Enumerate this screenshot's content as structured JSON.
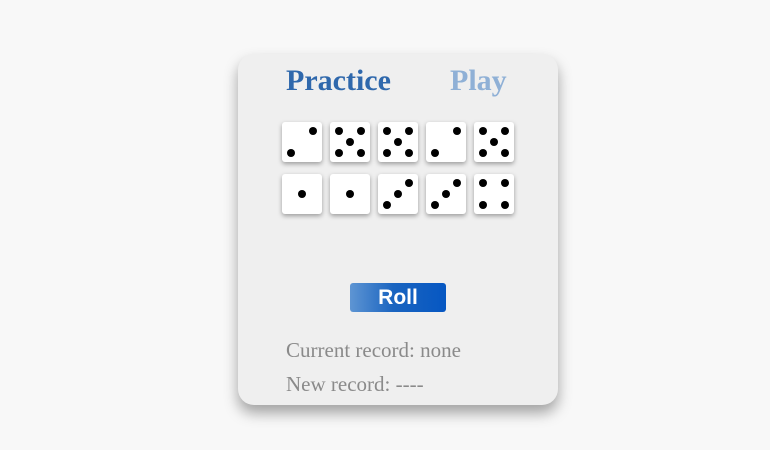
{
  "tabs": {
    "practice": "Practice",
    "play": "Play",
    "active": "practice"
  },
  "dice": [
    {
      "value": 2
    },
    {
      "value": 5
    },
    {
      "value": 5
    },
    {
      "value": 2
    },
    {
      "value": 5
    },
    {
      "value": 1
    },
    {
      "value": 1
    },
    {
      "value": 3
    },
    {
      "value": 3
    },
    {
      "value": 4
    }
  ],
  "roll_button": {
    "label": "Roll"
  },
  "records": {
    "current": "Current record: none",
    "new": "New record: ----"
  },
  "colors": {
    "active_tab": "#2f68ac",
    "inactive_tab": "#8fb0d6",
    "roll_button": "#0657c2",
    "record_text": "#8a8a8a"
  }
}
